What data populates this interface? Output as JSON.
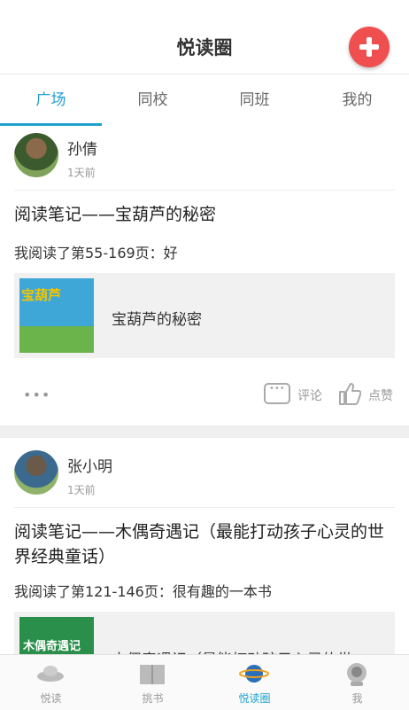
{
  "header": {
    "title": "悦读圈"
  },
  "tabs": [
    {
      "label": "广场"
    },
    {
      "label": "同校"
    },
    {
      "label": "同班"
    },
    {
      "label": "我的"
    }
  ],
  "posts": [
    {
      "user": "孙倩",
      "time": "1天前",
      "title": "阅读笔记——宝葫芦的秘密",
      "desc": "我阅读了第55-169页：好",
      "book": {
        "cover_title": "宝葫芦",
        "name": "宝葫芦的秘密"
      },
      "actions": {
        "comment": "评论",
        "like": "点赞"
      }
    },
    {
      "user": "张小明",
      "time": "1天前",
      "title": "阅读笔记——木偶奇遇记（最能打动孩子心灵的世界经典童话）",
      "desc": "我阅读了第121-146页：很有趣的一本书",
      "book": {
        "cover_title": "木偶奇遇记",
        "name": "木偶奇遇记（最能打动孩子心灵的世"
      }
    }
  ],
  "tabbar": [
    {
      "label": "悦读",
      "icon": "ufo-icon"
    },
    {
      "label": "挑书",
      "icon": "book-icon"
    },
    {
      "label": "悦读圈",
      "icon": "planet-icon"
    },
    {
      "label": "我",
      "icon": "robot-icon"
    }
  ],
  "colors": {
    "accent": "#1fa0cf",
    "add_button": "#ef4f4f"
  }
}
